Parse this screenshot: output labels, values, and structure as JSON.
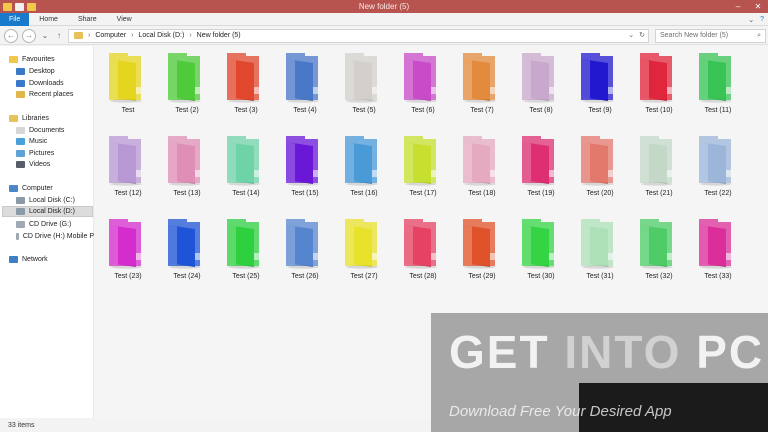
{
  "window": {
    "title": "New folder (5)",
    "min_glyph": "–",
    "close_glyph": "✕"
  },
  "ribbon": {
    "tabs": [
      "File",
      "Home",
      "Share",
      "View"
    ]
  },
  "address": {
    "crumbs": [
      "Computer",
      "Local Disk (D:)",
      "New folder (5)"
    ],
    "search_placeholder": "Search New folder (5)"
  },
  "sidebar": {
    "favourites": {
      "label": "Favourites",
      "items": [
        "Desktop",
        "Downloads",
        "Recent places"
      ]
    },
    "libraries": {
      "label": "Libraries",
      "items": [
        "Documents",
        "Music",
        "Pictures",
        "Videos"
      ]
    },
    "computer": {
      "label": "Computer",
      "items": [
        "Local Disk (C:)",
        "Local Disk (D:)",
        "CD Drive (G:)",
        "CD Drive (H:) Mobile P"
      ]
    },
    "network": {
      "label": "Network"
    }
  },
  "files": [
    {
      "label": "Test",
      "color": "#e4d61f"
    },
    {
      "label": "Test (2)",
      "color": "#4fca3a"
    },
    {
      "label": "Test (3)",
      "color": "#e0472d"
    },
    {
      "label": "Test (4)",
      "color": "#4a78c9"
    },
    {
      "label": "Test (5)",
      "color": "#d3d0cc"
    },
    {
      "label": "Test (6)",
      "color": "#c84cc8"
    },
    {
      "label": "Test (7)",
      "color": "#e38a3c"
    },
    {
      "label": "Test (8)",
      "color": "#c8a8cc"
    },
    {
      "label": "Test (9)",
      "color": "#2218d0"
    },
    {
      "label": "Test (10)",
      "color": "#e0263d"
    },
    {
      "label": "Test (11)",
      "color": "#38c454"
    },
    {
      "label": "Test (12)",
      "color": "#b898d4"
    },
    {
      "label": "Test (13)",
      "color": "#df8fb6"
    },
    {
      "label": "Test (14)",
      "color": "#6fd3a8"
    },
    {
      "label": "Test (15)",
      "color": "#6a17d8"
    },
    {
      "label": "Test (16)",
      "color": "#4a9ad8"
    },
    {
      "label": "Test (17)",
      "color": "#c7e030"
    },
    {
      "label": "Test (18)",
      "color": "#e5aac0"
    },
    {
      "label": "Test (19)",
      "color": "#de2f73"
    },
    {
      "label": "Test (20)",
      "color": "#e3786d"
    },
    {
      "label": "Test (21)",
      "color": "#c4d8c8"
    },
    {
      "label": "Test (22)",
      "color": "#9cb6da"
    },
    {
      "label": "Test (23)",
      "color": "#d42ccd"
    },
    {
      "label": "Test (24)",
      "color": "#1f54d6"
    },
    {
      "label": "Test (25)",
      "color": "#2ed040"
    },
    {
      "label": "Test (26)",
      "color": "#5585cf"
    },
    {
      "label": "Test (27)",
      "color": "#e8e22b"
    },
    {
      "label": "Test (28)",
      "color": "#e64263"
    },
    {
      "label": "Test (29)",
      "color": "#e0522a"
    },
    {
      "label": "Test (30)",
      "color": "#34d444"
    },
    {
      "label": "Test (31)",
      "color": "#aee0b8"
    },
    {
      "label": "Test (32)",
      "color": "#4fcc67"
    },
    {
      "label": "Test (33)",
      "color": "#dc2e9a"
    }
  ],
  "status": {
    "item_count": "33 items"
  },
  "watermark": {
    "title_get": "GET",
    "title_into": "INTO",
    "title_pc": "PC",
    "subtitle": "Download Free Your Desired App"
  }
}
